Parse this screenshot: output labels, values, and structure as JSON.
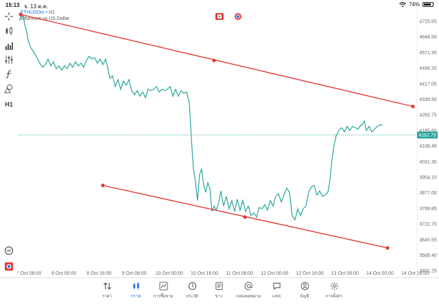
{
  "status_bar": {
    "time": "15:13",
    "date": "จ. 13 ต.ค.",
    "battery": "74%",
    "battery_level": 0.74
  },
  "chart_header": {
    "symbol": "ETHUSDm",
    "timeframe": "H1",
    "description": "Ethereum vs US Dollar"
  },
  "left_toolbar": {
    "timeframe_label": "H1",
    "icons": [
      "crosshair-icon",
      "candlestick-icon",
      "bar-chart-icon",
      "indicators-icon",
      "function-icon",
      "shapes-icon",
      "timeframe-label",
      "search-chart-icon",
      "broker-logo-icon"
    ]
  },
  "price_axis": {
    "ticks": [
      "4725.65",
      "4648.50",
      "4571.35",
      "4494.20",
      "4417.05",
      "4339.90",
      "4262.75",
      "4185.60",
      "4108.45",
      "4031.30",
      "3954.15",
      "3877.00",
      "3799.85",
      "3722.70",
      "3645.55",
      "3568.40",
      "3491.25"
    ],
    "current_price": "4162.79",
    "current_price_color": "#26a69a"
  },
  "time_axis": {
    "ticks": [
      "7 Oct 08:00",
      "8 Oct 00:00",
      "8 Oct 16:00",
      "9 Oct 08:00",
      "10 Oct 00:00",
      "10 Oct 16:00",
      "11 Oct 08:00",
      "12 Oct 00:00",
      "12 Oct 16:00",
      "13 Oct 08:00",
      "14 Oct 00:00",
      "14 Oct 16:00"
    ]
  },
  "colors": {
    "line": "#26a69a",
    "trendline": "#e53935",
    "accent": "#1a73e8"
  },
  "tab_bar": {
    "tabs": [
      {
        "label": "ราคา",
        "icon": "quotes-icon",
        "active": false
      },
      {
        "label": "กราฟ",
        "icon": "chart-icon",
        "active": true
      },
      {
        "label": "การซื้อขาย",
        "icon": "trade-icon",
        "active": false
      },
      {
        "label": "ประวัติ",
        "icon": "history-icon",
        "active": false
      },
      {
        "label": "ข่าว",
        "icon": "news-icon",
        "active": false
      },
      {
        "label": "กล่องจดหมาย",
        "icon": "mailbox-icon",
        "active": false
      },
      {
        "label": "แชท",
        "icon": "chat-icon",
        "active": false
      },
      {
        "label": "บัญชี",
        "icon": "account-icon",
        "active": false
      },
      {
        "label": "การตั้งค่า",
        "icon": "settings-icon",
        "active": false
      }
    ]
  }
}
